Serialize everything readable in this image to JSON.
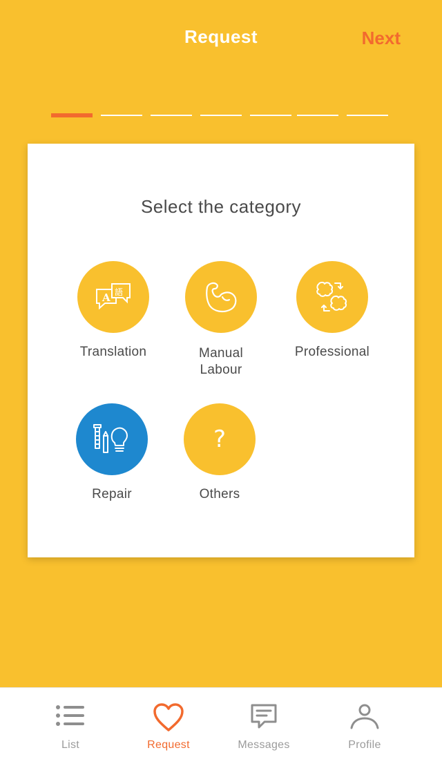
{
  "header": {
    "title": "Request",
    "next_label": "Next"
  },
  "progress": {
    "current_step": 1,
    "total_steps": 7
  },
  "card": {
    "title": "Select the category",
    "categories": [
      {
        "label": "Translation",
        "icon": "translation-icon",
        "selected": false
      },
      {
        "label": "Manual\nLabour",
        "icon": "flexed-arm-icon",
        "selected": false
      },
      {
        "label": "Professional",
        "icon": "brain-exchange-icon",
        "selected": false
      },
      {
        "label": "Repair",
        "icon": "tools-bulb-icon",
        "selected": true
      },
      {
        "label": "Others",
        "icon": "question-mark-icon",
        "selected": false
      }
    ]
  },
  "tabbar": {
    "items": [
      {
        "label": "List",
        "icon": "list-icon",
        "active": false
      },
      {
        "label": "Request",
        "icon": "heart-icon",
        "active": true
      },
      {
        "label": "Messages",
        "icon": "message-icon",
        "active": false
      },
      {
        "label": "Profile",
        "icon": "person-icon",
        "active": false
      }
    ]
  },
  "colors": {
    "background": "#F9C02E",
    "accent": "#F26A2E",
    "selected": "#1E88CF",
    "text": "#4a4a4a",
    "inactive": "#9b9b9b"
  }
}
